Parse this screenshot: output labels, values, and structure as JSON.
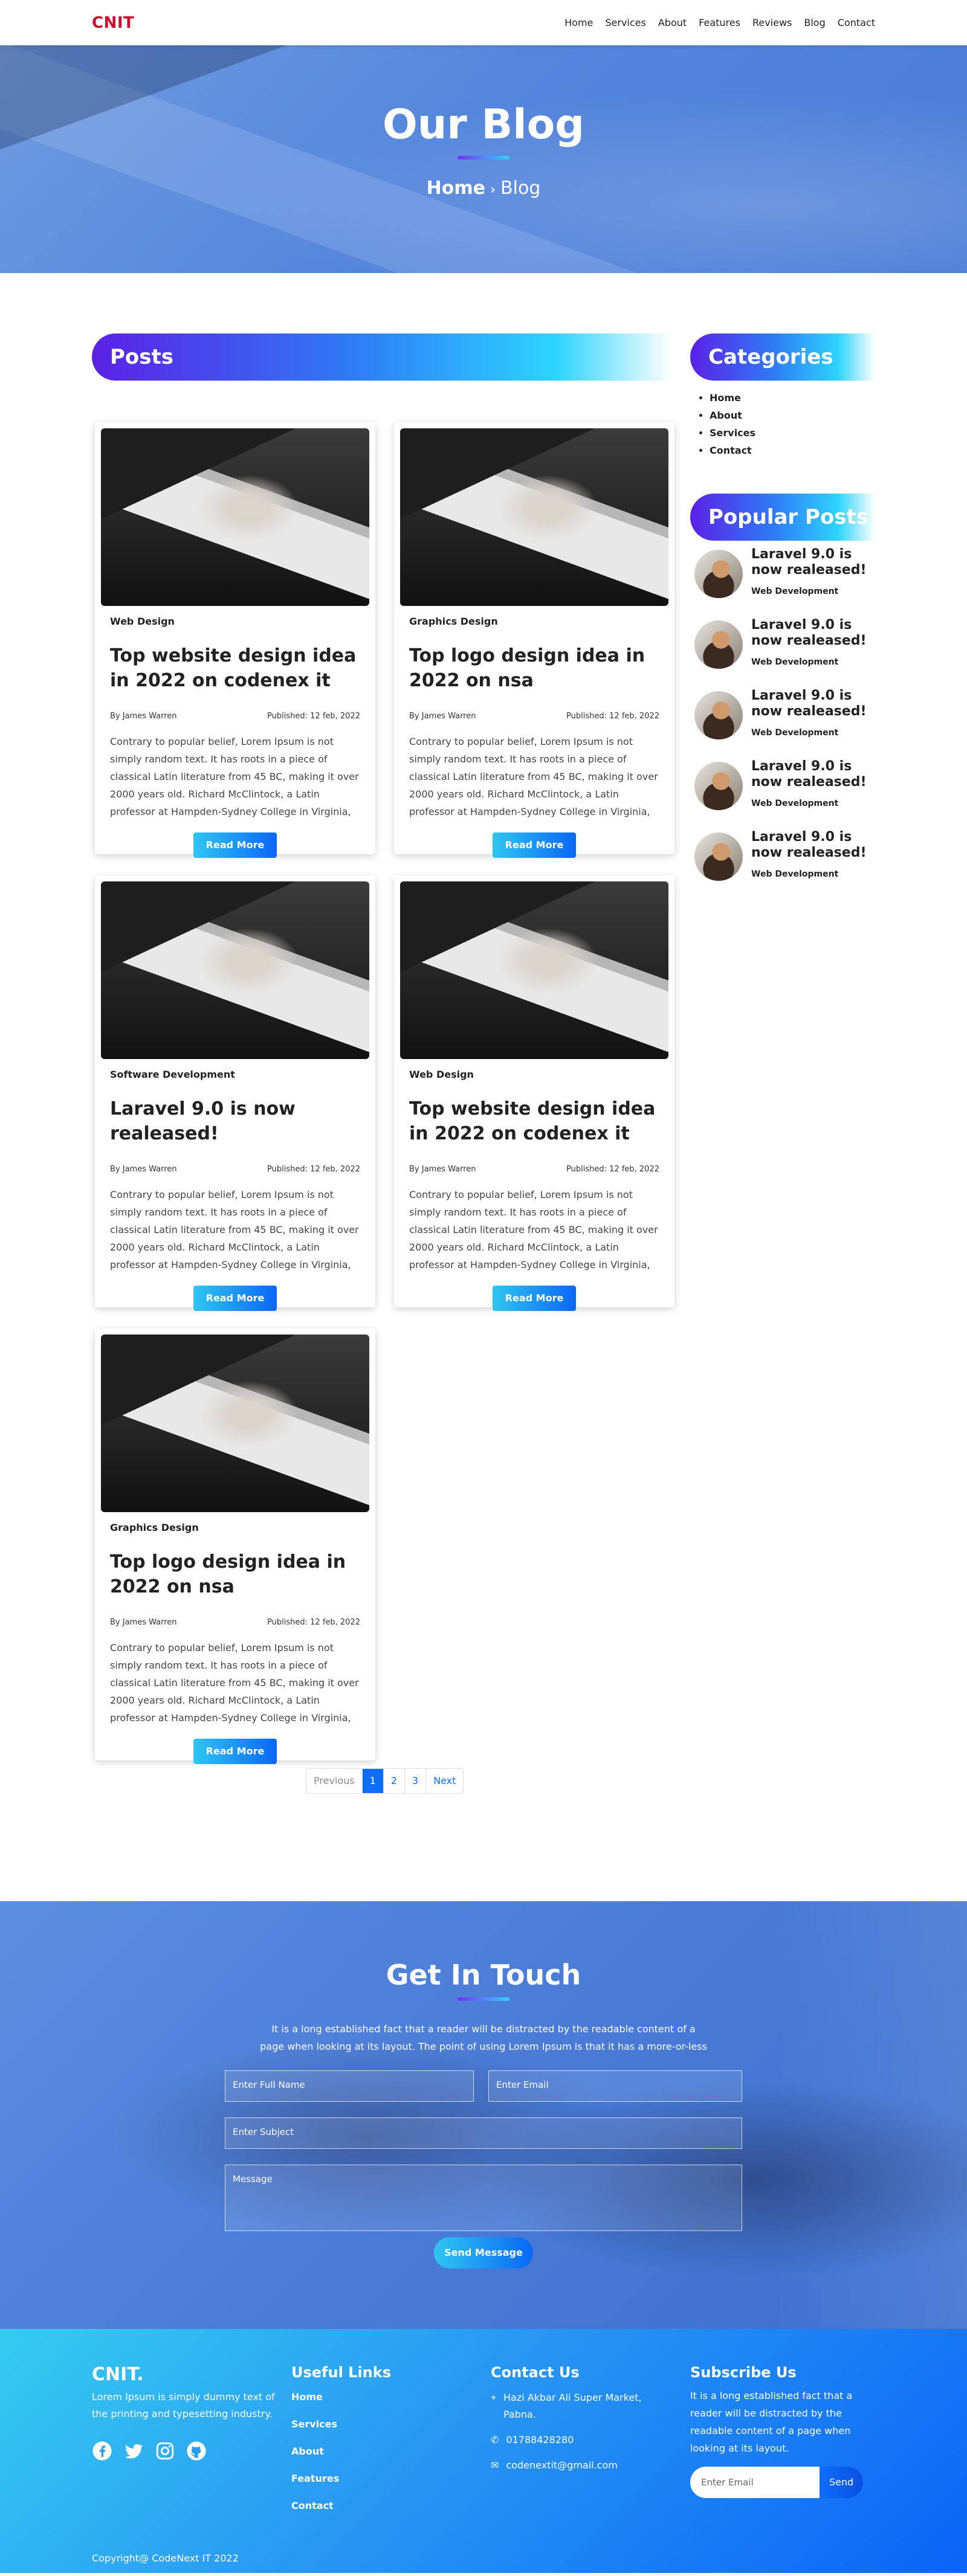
{
  "nav": {
    "brand": "CNIT",
    "items": [
      "Home",
      "Services",
      "About",
      "Features",
      "Reviews",
      "Blog",
      "Contact"
    ]
  },
  "hero": {
    "title": "Our Blog",
    "breadcrumb_home": "Home",
    "breadcrumb_separator": "›",
    "breadcrumb_current": "Blog"
  },
  "posts_heading": "Posts",
  "posts": [
    {
      "category": "Web Design",
      "title": "Top website design idea in 2022 on codenex it",
      "author": "By James Warren",
      "published": "Published: 12 feb, 2022",
      "excerpt": "Contrary to popular belief, Lorem Ipsum is not simply random text. It has roots in a piece of classical Latin literature from 45 BC, making it over 2000 years old. Richard McClintock, a Latin professor at Hampden-Sydney College in Virginia,",
      "button": "Read More"
    },
    {
      "category": "Graphics Design",
      "title": "Top logo design idea in 2022 on nsa",
      "author": "By James Warren",
      "published": "Published: 12 feb, 2022",
      "excerpt": "Contrary to popular belief, Lorem Ipsum is not simply random text. It has roots in a piece of classical Latin literature from 45 BC, making it over 2000 years old. Richard McClintock, a Latin professor at Hampden-Sydney College in Virginia,",
      "button": "Read More"
    },
    {
      "category": "Software Development",
      "title": "Laravel 9.0 is now realeased!",
      "author": "By James Warren",
      "published": "Published: 12 feb, 2022",
      "excerpt": "Contrary to popular belief, Lorem Ipsum is not simply random text. It has roots in a piece of classical Latin literature from 45 BC, making it over 2000 years old. Richard McClintock, a Latin professor at Hampden-Sydney College in Virginia,",
      "button": "Read More"
    },
    {
      "category": "Web Design",
      "title": "Top website design idea in 2022 on codenex it",
      "author": "By James Warren",
      "published": "Published: 12 feb, 2022",
      "excerpt": "Contrary to popular belief, Lorem Ipsum is not simply random text. It has roots in a piece of classical Latin literature from 45 BC, making it over 2000 years old. Richard McClintock, a Latin professor at Hampden-Sydney College in Virginia,",
      "button": "Read More"
    },
    {
      "category": "Graphics Design",
      "title": "Top logo design idea in 2022 on nsa",
      "author": "By James Warren",
      "published": "Published: 12 feb, 2022",
      "excerpt": "Contrary to popular belief, Lorem Ipsum is not simply random text. It has roots in a piece of classical Latin literature from 45 BC, making it over 2000 years old. Richard McClintock, a Latin professor at Hampden-Sydney College in Virginia,",
      "button": "Read More"
    }
  ],
  "sidebar": {
    "categories_heading": "Categories",
    "categories": [
      "Home",
      "About",
      "Services",
      "Contact"
    ],
    "popular_heading": "Popular Posts",
    "popular": [
      {
        "title": "Laravel 9.0 is now realeased!",
        "category": "Web Development"
      },
      {
        "title": "Laravel 9.0 is now realeased!",
        "category": "Web Development"
      },
      {
        "title": "Laravel 9.0 is now realeased!",
        "category": "Web Development"
      },
      {
        "title": "Laravel 9.0 is now realeased!",
        "category": "Web Development"
      },
      {
        "title": "Laravel 9.0 is now realeased!",
        "category": "Web Development"
      }
    ]
  },
  "pagination": {
    "previous": "Previous",
    "pages": [
      "1",
      "2",
      "3"
    ],
    "current": "1",
    "next": "Next"
  },
  "contact": {
    "title": "Get In Touch",
    "lead": "It is a long established fact that a reader will be distracted by the readable content of a page when looking at its layout. The point of using Lorem Ipsum is that it has a more-or-less",
    "name_placeholder": "Enter Full Name",
    "email_placeholder": "Enter Email",
    "subject_placeholder": "Enter Subject",
    "message_placeholder": "Message",
    "send_label": "Send Message"
  },
  "footer": {
    "brand": "CNIT.",
    "about": "Lorem Ipsum is simply dummy text of the printing and typesetting industry.",
    "social_icons": [
      "facebook-icon",
      "twitter-icon",
      "instagram-icon",
      "github-icon"
    ],
    "links_heading": "Useful Links",
    "links": [
      "Home",
      "Services",
      "About",
      "Features",
      "Contact"
    ],
    "contact_heading": "Contact Us",
    "address": "Hazi Akbar Ali Super Market, Pabna.",
    "phone": "01788428280",
    "email": "codenextit@gmail.com",
    "subscribe_heading": "Subscribe Us",
    "subscribe_text": "It is a long established fact that a reader will be distracted by the readable content of a page when looking at its layout.",
    "subscribe_placeholder": "Enter Email",
    "subscribe_button": "Send",
    "copyright": "Copyright@ CodeNext IT 2022"
  }
}
